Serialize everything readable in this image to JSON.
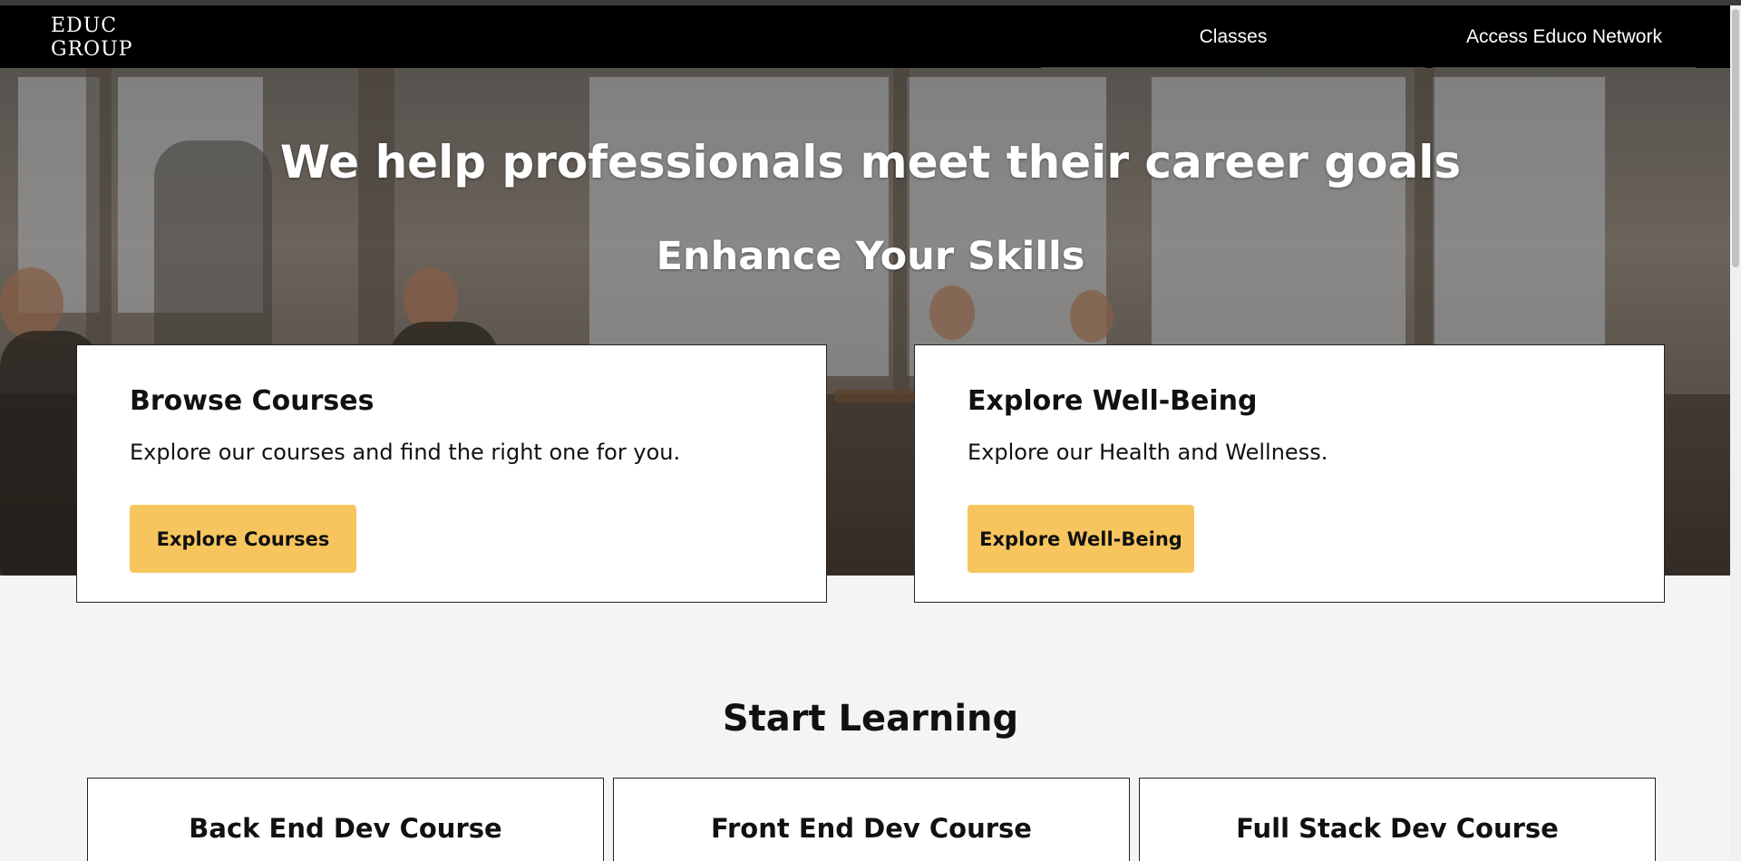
{
  "header": {
    "logo_line1": "EDUC",
    "logo_line2": "GROUP",
    "nav": [
      {
        "label": "Classes"
      },
      {
        "label": "Access Educo Network"
      }
    ]
  },
  "hero": {
    "title": "We help professionals meet their career goals",
    "subtitle": "Enhance Your Skills"
  },
  "cards": [
    {
      "title": "Browse Courses",
      "description": "Explore our courses and find the right one for you.",
      "button": "Explore Courses"
    },
    {
      "title": "Explore Well-Being",
      "description": "Explore our Health and Wellness.",
      "button": "Explore Well-Being"
    }
  ],
  "learning": {
    "title": "Start Learning",
    "courses": [
      {
        "title": "Back End Dev Course"
      },
      {
        "title": "Front End Dev Course"
      },
      {
        "title": "Full Stack Dev Course"
      }
    ]
  },
  "colors": {
    "accent": "#f7c55e",
    "nav_bg": "#000000",
    "page_bg": "#f4f4f4"
  }
}
